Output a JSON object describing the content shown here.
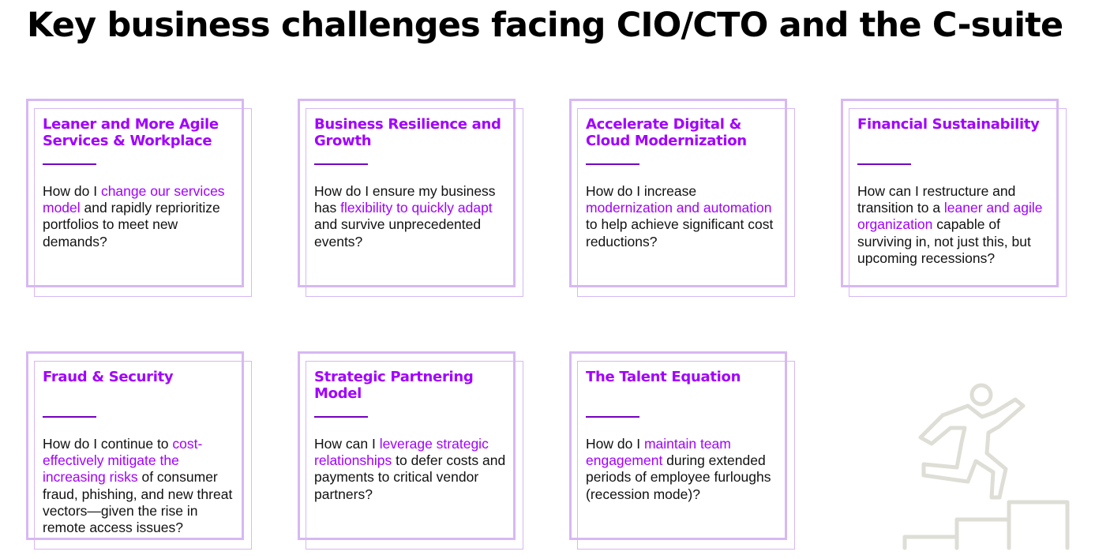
{
  "title": "Key business challenges facing CIO/CTO and the C-suite",
  "accent_color": "#a100ff",
  "frame_color": "#d7b8f3",
  "cards": [
    {
      "heading": "Leaner and More Agile Services & Workplace",
      "body": [
        {
          "t": "How do I ",
          "hl": false
        },
        {
          "t": "change our services model",
          "hl": true
        },
        {
          "t": " and rapidly reprioritize portfolios to meet new demands?",
          "hl": false
        }
      ]
    },
    {
      "heading": "Business Resilience and Growth",
      "body": [
        {
          "t": "How do I ensure my business has ",
          "hl": false
        },
        {
          "t": "flexibility to quickly adapt",
          "hl": true
        },
        {
          "t": " and survive unprecedented events?",
          "hl": false
        }
      ]
    },
    {
      "heading": "Accelerate Digital & Cloud Modernization",
      "body": [
        {
          "t": "How do I increase ",
          "hl": false
        },
        {
          "t": "modernization and automation",
          "hl": true
        },
        {
          "t": " to help achieve significant cost reductions?",
          "hl": false
        }
      ]
    },
    {
      "heading": "Financial Sustainability",
      "body": [
        {
          "t": "How can I restructure and transition to a ",
          "hl": false
        },
        {
          "t": "leaner and agile organization",
          "hl": true
        },
        {
          "t": " capable of surviving in, not just this, but upcoming recessions?",
          "hl": false
        }
      ]
    },
    {
      "heading": "Fraud & Security",
      "body": [
        {
          "t": "How do I continue to ",
          "hl": false
        },
        {
          "t": "cost-effectively mitigate the increasing risks",
          "hl": true
        },
        {
          "t": " of consumer fraud, phishing, and new threat vectors—given the rise in remote access issues?",
          "hl": false
        }
      ]
    },
    {
      "heading": "Strategic Partnering Model",
      "body": [
        {
          "t": "How can I ",
          "hl": false
        },
        {
          "t": "leverage strategic relationships",
          "hl": true
        },
        {
          "t": " to defer costs and payments to critical vendor partners?",
          "hl": false
        }
      ]
    },
    {
      "heading": "The Talent Equation",
      "body": [
        {
          "t": "How do I ",
          "hl": false
        },
        {
          "t": "maintain team engagement",
          "hl": true
        },
        {
          "t": " during extended periods of employee furloughs (recession mode)?",
          "hl": false
        }
      ]
    }
  ],
  "illustration": {
    "icon": "person-climbing-stairs-icon",
    "color": "#deded6"
  }
}
